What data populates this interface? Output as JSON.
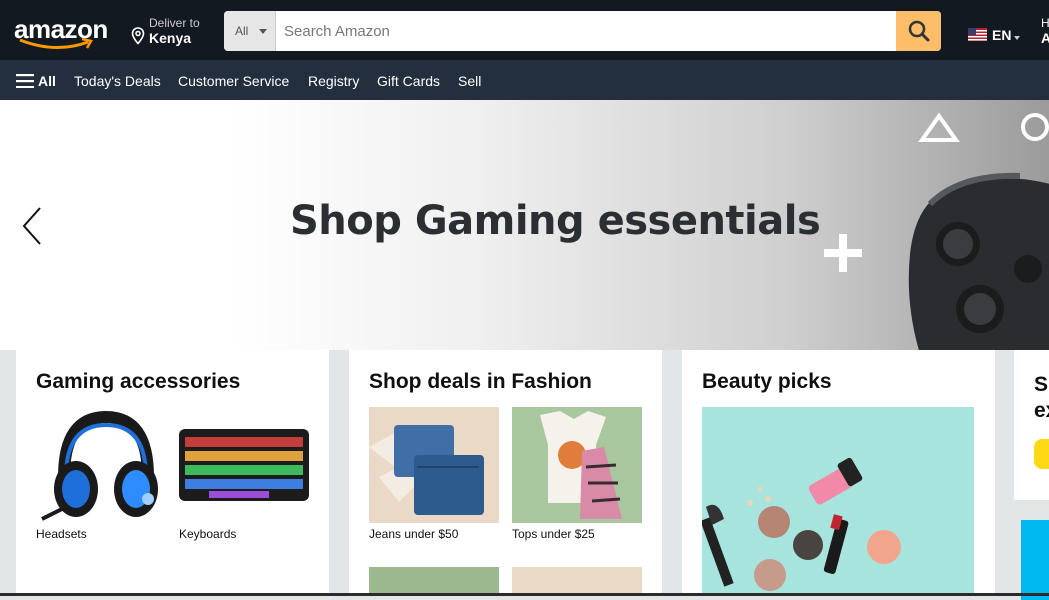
{
  "header": {
    "logo_text": "amazon",
    "deliver_label": "Deliver to",
    "deliver_location": "Kenya",
    "search_category": "All",
    "search_placeholder": "Search Amazon",
    "language": "EN",
    "account_line1": "H",
    "account_line2": "A"
  },
  "nav": {
    "all_label": "All",
    "items": [
      "Today's Deals",
      "Customer Service",
      "Registry",
      "Gift Cards",
      "Sell"
    ]
  },
  "hero": {
    "title": "Shop Gaming essentials"
  },
  "cards": [
    {
      "title": "Gaming accessories",
      "tiles": [
        {
          "caption": "Headsets",
          "icon": "headset-image"
        },
        {
          "caption": "Keyboards",
          "icon": "keyboard-image"
        }
      ]
    },
    {
      "title": "Shop deals in Fashion",
      "tiles": [
        {
          "caption": "Jeans under $50",
          "icon": "jeans-image"
        },
        {
          "caption": "Tops under $25",
          "icon": "tops-image"
        }
      ]
    },
    {
      "title": "Beauty picks",
      "tiles": []
    }
  ],
  "partial_card": {
    "title_line1": "S",
    "title_line2": "ex"
  },
  "colors": {
    "header_bg": "#131921",
    "nav_bg": "#232f3e",
    "search_button": "#febd69",
    "page_bg": "#e3e6e6",
    "beauty_bg": "#a7e4dd"
  }
}
